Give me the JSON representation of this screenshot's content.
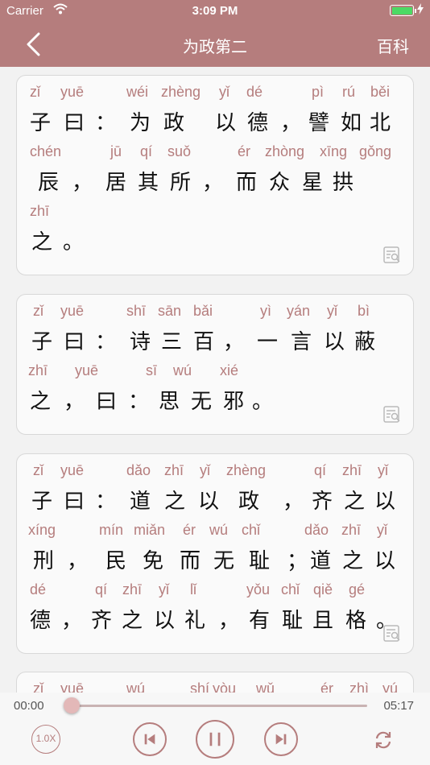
{
  "status": {
    "carrier": "Carrier",
    "time": "3:09 PM"
  },
  "nav": {
    "title": "为政第二",
    "right": "百科",
    "back_icon": "chevron-left-icon"
  },
  "cards": [
    {
      "lines": [
        {
          "py": [
            "zǐ",
            "yuē",
            "wéi",
            "zhèng",
            "yǐ",
            "dé",
            "pì",
            "rú",
            "běi"
          ],
          "hz": [
            "子",
            "曰",
            "：",
            "为",
            "政",
            "以",
            "德",
            "，",
            "譬",
            "如",
            "北"
          ]
        },
        {
          "py": [
            "chén",
            "jū",
            "qí",
            "suǒ",
            "ér",
            "zhòng",
            "xīng",
            "gǒng"
          ],
          "hz": [
            "辰",
            "，",
            "居",
            "其",
            "所",
            "，",
            "而",
            "众",
            "星",
            "拱"
          ]
        },
        {
          "py": [
            "zhī"
          ],
          "hz": [
            "之",
            "。"
          ]
        }
      ]
    },
    {
      "lines": [
        {
          "py": [
            "zǐ",
            "yuē",
            "shī",
            "sān",
            "bǎi",
            "yì",
            "yán",
            "yǐ",
            "bì"
          ],
          "hz": [
            "子",
            "曰",
            "：",
            "诗",
            "三",
            "百",
            "，",
            "一",
            "言",
            "以",
            "蔽"
          ]
        },
        {
          "py": [
            "zhī",
            "yuē",
            "sī",
            "wú",
            "xié"
          ],
          "hz": [
            "之",
            "，",
            "曰",
            "：",
            "思",
            "无",
            "邪",
            "。"
          ]
        }
      ]
    },
    {
      "lines": [
        {
          "py": [
            "zǐ",
            "yuē",
            "dǎo",
            "zhī",
            "yǐ",
            "zhèng",
            "qí",
            "zhī",
            "yǐ"
          ],
          "hz": [
            "子",
            "曰",
            "：",
            "道",
            "之",
            "以",
            "政",
            "，",
            "齐",
            "之",
            "以"
          ]
        },
        {
          "py": [
            "xíng",
            "mín",
            "miǎn",
            "ér",
            "wú",
            "chǐ",
            "dǎo",
            "zhī",
            "yǐ"
          ],
          "hz": [
            "刑",
            "，",
            "民",
            "免",
            "而",
            "无",
            "耻",
            "；",
            "道",
            "之",
            "以"
          ]
        },
        {
          "py": [
            "dé",
            "qí",
            "zhī",
            "yǐ",
            "lǐ",
            "yǒu",
            "chǐ",
            "qiě",
            "gé"
          ],
          "hz": [
            "德",
            "，",
            "齐",
            "之",
            "以",
            "礼",
            "，",
            "有",
            "耻",
            "且",
            "格",
            "。"
          ]
        }
      ]
    },
    {
      "lines": [
        {
          "py": [
            "zǐ",
            "yuē",
            "wú",
            "shí",
            "yòu",
            "wǔ",
            "ér",
            "zhì",
            "yú"
          ],
          "hz": []
        }
      ]
    }
  ],
  "player": {
    "current": "00:00",
    "total": "05:17",
    "speed": "1.0X",
    "progress": 0.0
  }
}
